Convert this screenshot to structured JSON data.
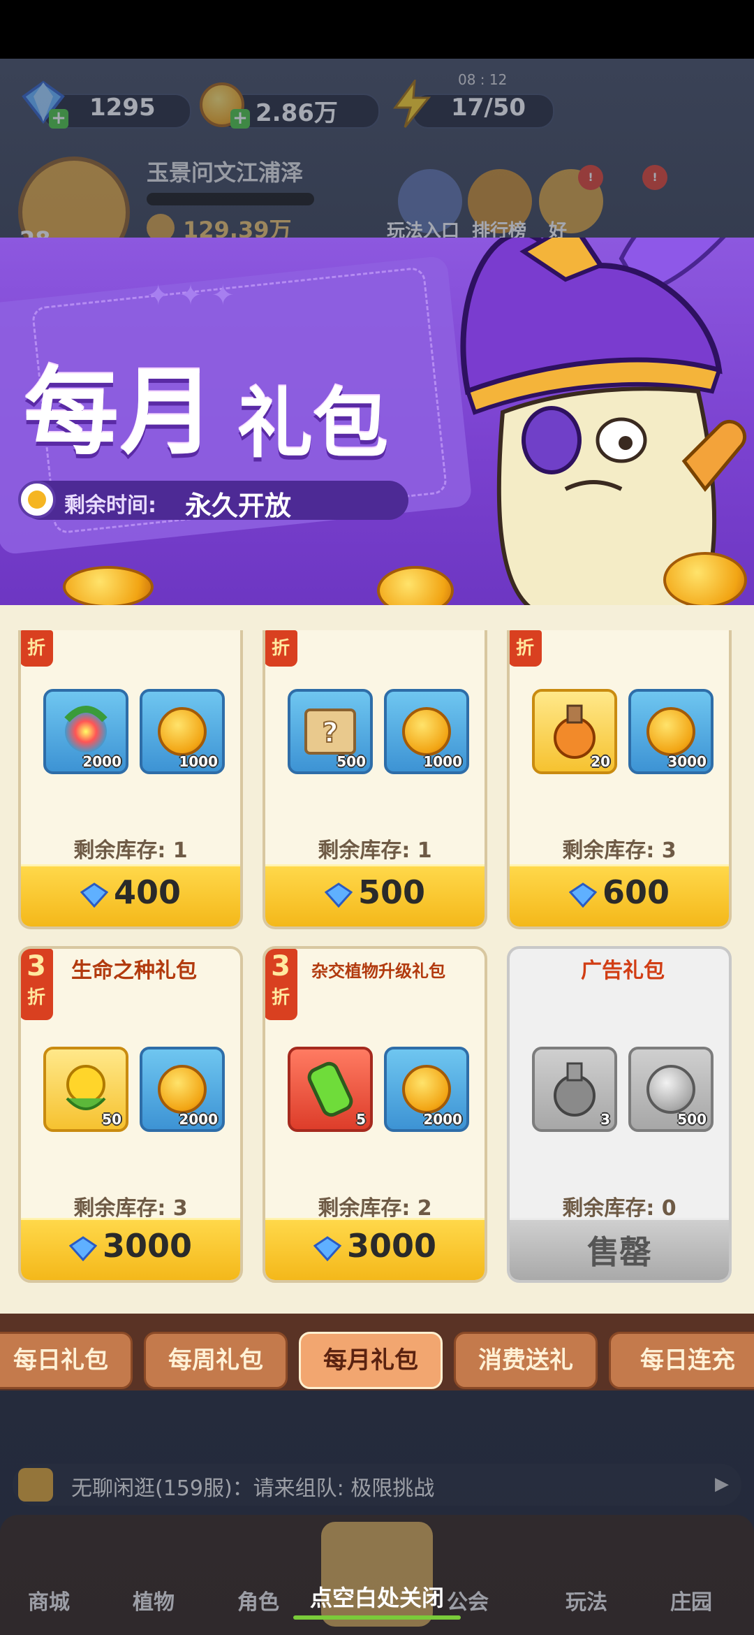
{
  "resources": {
    "gems": "1295",
    "coins": "2.86万",
    "energy": "17/50",
    "energy_timer": "08 : 12"
  },
  "player": {
    "name": "玉景问文江浦泽",
    "level": "28",
    "power": "129.39万"
  },
  "top_buttons": {
    "play_entry": "玩法入口",
    "ranking": "排行榜",
    "friends": "好"
  },
  "banner": {
    "title_part1": "每月",
    "title_part2": "礼包",
    "time_label": "剩余时间:",
    "time_value": "永久开放"
  },
  "cards": [
    {
      "title": "",
      "discount": "折",
      "items": [
        {
          "icon": "rainbow-seed-icon",
          "qty": "2000"
        },
        {
          "icon": "gold-coin-icon",
          "qty": "1000"
        }
      ],
      "stock": "剩余库存: 1",
      "price": "400"
    },
    {
      "title": "",
      "discount": "折",
      "items": [
        {
          "icon": "mystery-map-icon",
          "qty": "500"
        },
        {
          "icon": "gold-coin-icon",
          "qty": "1000"
        }
      ],
      "stock": "剩余库存: 1",
      "price": "500"
    },
    {
      "title": "",
      "discount": "折",
      "items": [
        {
          "icon": "potion-bottle-icon",
          "qty": "20"
        },
        {
          "icon": "gold-coin-icon",
          "qty": "3000"
        }
      ],
      "stock": "剩余库存: 3",
      "price": "600"
    },
    {
      "title": "生命之种礼包",
      "discount_num": "3",
      "discount": "折",
      "items": [
        {
          "icon": "life-seed-icon",
          "qty": "50"
        },
        {
          "icon": "gold-coin-icon",
          "qty": "2000"
        }
      ],
      "stock": "剩余库存: 3",
      "price": "3000"
    },
    {
      "title": "杂交植物升级礼包",
      "discount_num": "3",
      "discount": "折",
      "items": [
        {
          "icon": "green-capsule-icon",
          "qty": "5"
        },
        {
          "icon": "gold-coin-icon",
          "qty": "2000"
        }
      ],
      "stock": "剩余库存: 2",
      "price": "3000"
    },
    {
      "title": "广告礼包",
      "items": [
        {
          "icon": "potion-bottle-icon",
          "qty": "3"
        },
        {
          "icon": "silver-coin-icon",
          "qty": "500"
        }
      ],
      "stock": "剩余库存: 0",
      "price": "售罄"
    }
  ],
  "tabs": [
    "每日礼包",
    "每周礼包",
    "每月礼包",
    "消费送礼",
    "每日连充"
  ],
  "active_tab": "每月礼包",
  "chat": {
    "text": "无聊闲逛(159服)：请来组队: 极限挑战"
  },
  "bottom_nav": [
    "商城",
    "植物",
    "角色",
    "",
    "公会",
    "玩法",
    "庄园"
  ],
  "close_hint": "点空白处关闭",
  "colors": {
    "banner_purple": "#7b42d0",
    "price_gold": "#f4b81a",
    "tab_active": "#f2a670"
  }
}
